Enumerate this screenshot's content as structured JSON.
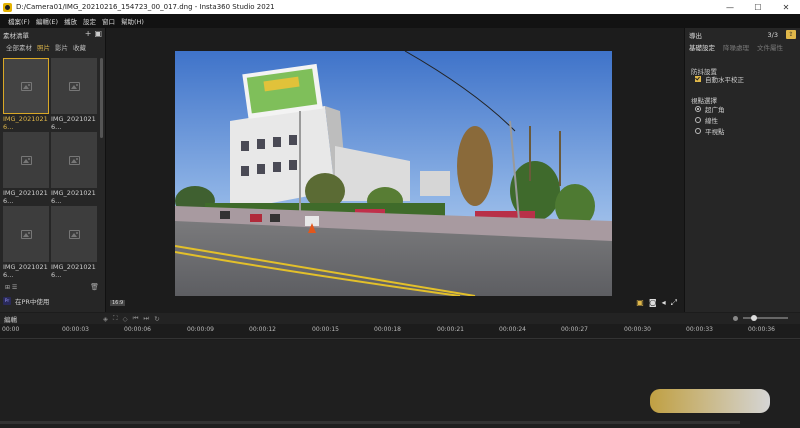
{
  "window": {
    "title": "D:/Camera01/IMG_20210216_154723_00_017.dng - Insta360 Studio 2021",
    "buttons": {
      "minimize": "—",
      "maximize": "☐",
      "close": "✕"
    }
  },
  "menu": [
    "檔案(F)",
    "編輯(E)",
    "播放",
    "設定",
    "窗口",
    "幫助(H)"
  ],
  "left_panel": {
    "title": "素材清單",
    "add_icon": "+",
    "tabs": [
      {
        "label": "全部素材",
        "active": false
      },
      {
        "label": "照片",
        "active": true
      },
      {
        "label": "影片",
        "active": false
      },
      {
        "label": "收藏",
        "active": false
      }
    ],
    "thumbnails": [
      {
        "label": "IMG_2021021\n6...",
        "selected": true
      },
      {
        "label": "IMG_2021021\n6...",
        "selected": false
      },
      {
        "label": "IMG_2021021\n6...",
        "selected": false
      },
      {
        "label": "IMG_2021021\n6...",
        "selected": false
      },
      {
        "label": "IMG_2021021\n6...",
        "selected": false
      },
      {
        "label": "IMG_2021021\n6...",
        "selected": false
      }
    ],
    "bottom_icons": "⊞ ☰",
    "trash_icon": "🗑",
    "pr_badge": "Pr",
    "pr_label": "在PR中使用"
  },
  "preview": {
    "tag": "16:9",
    "tools": [
      "screenshot-icon",
      "camera-icon",
      "volume-icon",
      "fullscreen-icon"
    ]
  },
  "right_panel": {
    "title": "導出",
    "page": "3/3",
    "tabs": [
      {
        "label": "基礎設定",
        "active": true
      },
      {
        "label": "降噪處理",
        "active": false
      },
      {
        "label": "文件屬性",
        "active": false
      }
    ],
    "stabilization": {
      "heading": "防抖設置",
      "checkbox_label": "自動水平校正",
      "checked": true
    },
    "view": {
      "heading": "視點選擇",
      "options": [
        {
          "label": "超广角",
          "selected": true
        },
        {
          "label": "線性",
          "selected": false
        },
        {
          "label": "平視點",
          "selected": false
        }
      ]
    }
  },
  "timeline": {
    "title": "編輯",
    "ticks": [
      "00:00",
      "00:00:03",
      "00:00:06",
      "00:00:09",
      "00:00:12",
      "00:00:15",
      "00:00:18",
      "00:00:21",
      "00:00:24",
      "00:00:27",
      "00:00:30",
      "00:00:33",
      "00:00:36"
    ]
  },
  "colors": {
    "accent": "#e0b84a",
    "panel": "#262626",
    "background": "#1c1c1c"
  }
}
